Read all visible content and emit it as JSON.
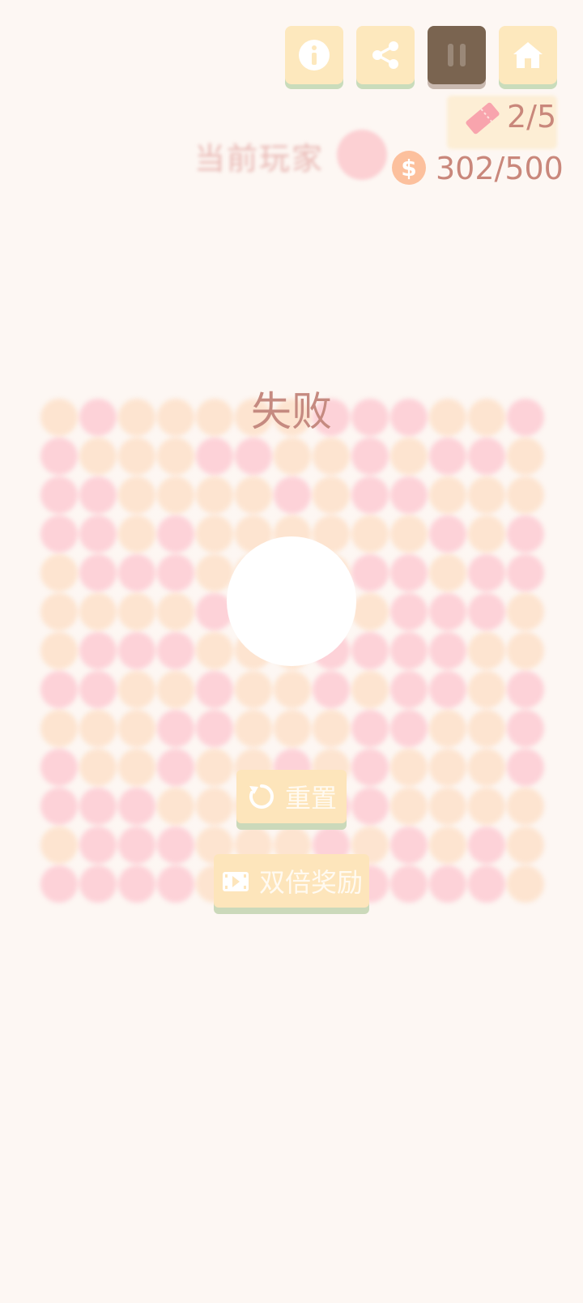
{
  "toolbar": {
    "buttons": [
      {
        "name": "info",
        "icon": "info-icon"
      },
      {
        "name": "share",
        "icon": "share-icon"
      },
      {
        "name": "pause",
        "icon": "pause-icon"
      },
      {
        "name": "home",
        "icon": "home-icon"
      }
    ]
  },
  "stats": {
    "tickets": "2/5",
    "coin_symbol": "$",
    "coins": "302/500"
  },
  "player": {
    "label": "当前玩家"
  },
  "result": {
    "title": "失败"
  },
  "actions": {
    "reset_label": "重置",
    "double_reward_label": "双倍奖励"
  },
  "colors": {
    "background": "#fdf7f3",
    "pink": "#fdd2d8",
    "peach": "#fde4d0",
    "button": "#fde8bd",
    "button_dark": "#7a6450",
    "text_accent": "#c9877b"
  },
  "board": {
    "rows": [
      "ppppppppppppp",
      "pppppppppppoo",
      "ppppppppppppp",
      "ppppppppppppp",
      "ppppppppppppp",
      "ppppppppppppp",
      "ppppppppppppp",
      "ppppppppppppp",
      "ppppppppppppp",
      "ppppppppppppp",
      "ppppppppppppp",
      "ppppppppppppp",
      "ppppppppppppp"
    ],
    "pattern": [
      "oporooopppoop",
      "poooppoopoppo",
      "ppoooopoppooo",
      "ppopoooooopop",
      "opppooooppopp",
      "oooopoooopppo",
      "opppoooppppoo",
      "ppoopoopoppop",
      "oooppoooppoop",
      "poopoopopooop",
      "pppooopppoooo",
      "opppooopopopo",
      "ppppooopppppo"
    ]
  }
}
